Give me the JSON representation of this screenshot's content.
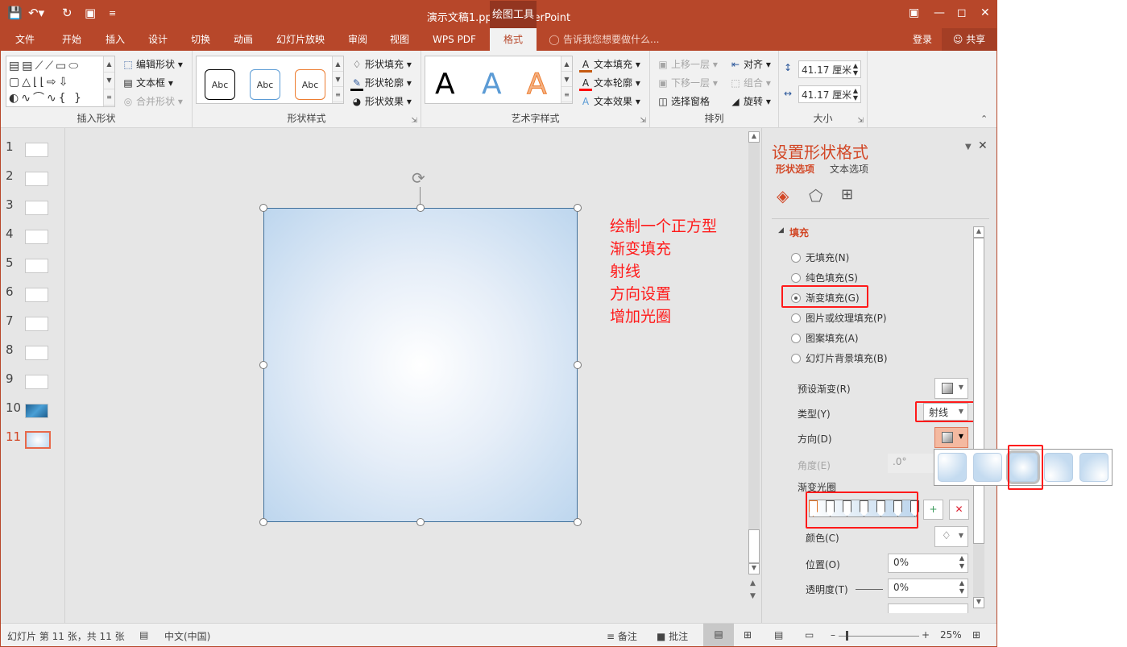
{
  "titlebar": {
    "title": "演示文稿1.pptx - PowerPoint",
    "context_tool": "绘图工具",
    "quick_access": [
      "save-icon",
      "undo-icon",
      "redo-icon",
      "present-icon",
      "customize-icon"
    ],
    "window_controls": [
      "ribbon-display-icon",
      "minimize-icon",
      "maximize-icon",
      "close-icon"
    ]
  },
  "tabs": [
    {
      "label": "文件"
    },
    {
      "label": "开始"
    },
    {
      "label": "插入"
    },
    {
      "label": "设计"
    },
    {
      "label": "切换"
    },
    {
      "label": "动画"
    },
    {
      "label": "幻灯片放映"
    },
    {
      "label": "审阅"
    },
    {
      "label": "视图"
    },
    {
      "label": "WPS PDF"
    },
    {
      "label": "格式",
      "active": true
    }
  ],
  "tell_me": "告诉我您想要做什么...",
  "login": "登录",
  "share": "共享",
  "ribbon": {
    "insert_shapes": {
      "label": "插入形状",
      "edit_shape": "编辑形状",
      "textbox": "文本框",
      "merge_shapes": "合并形状"
    },
    "shape_styles": {
      "label": "形状样式",
      "samples": [
        "Abc",
        "Abc",
        "Abc"
      ],
      "fill": "形状填充",
      "outline": "形状轮廓",
      "effects": "形状效果"
    },
    "wordart_styles": {
      "label": "艺术字样式",
      "samples": [
        "A",
        "A",
        "A"
      ],
      "text_fill": "文本填充",
      "text_outline": "文本轮廓",
      "text_effects": "文本效果"
    },
    "arrange": {
      "label": "排列",
      "bring_forward": "上移一层",
      "send_backward": "下移一层",
      "selection_pane": "选择窗格",
      "align": "对齐",
      "group": "组合",
      "rotate": "旋转"
    },
    "size": {
      "label": "大小",
      "height": "41.17 厘米",
      "width": "41.17 厘米"
    }
  },
  "thumbnails": [
    {
      "n": "1"
    },
    {
      "n": "2"
    },
    {
      "n": "3"
    },
    {
      "n": "4"
    },
    {
      "n": "5"
    },
    {
      "n": "6"
    },
    {
      "n": "7"
    },
    {
      "n": "8"
    },
    {
      "n": "9"
    },
    {
      "n": "10"
    },
    {
      "n": "11",
      "selected": true
    }
  ],
  "annotation": [
    "绘制一个正方型",
    "渐变填充",
    "射线",
    "方向设置",
    "增加光圈"
  ],
  "pane": {
    "title": "设置形状格式",
    "tab_shape": "形状选项",
    "tab_text": "文本选项",
    "section": "填充",
    "fill_options": [
      {
        "label": "无填充(N)",
        "checked": false
      },
      {
        "label": "纯色填充(S)",
        "checked": false
      },
      {
        "label": "渐变填充(G)",
        "checked": true
      },
      {
        "label": "图片或纹理填充(P)",
        "checked": false
      },
      {
        "label": "图案填充(A)",
        "checked": false
      },
      {
        "label": "幻灯片背景填充(B)",
        "checked": false
      }
    ],
    "preset_gradient": "预设渐变(R)",
    "type_label": "类型(Y)",
    "type_value": "射线",
    "direction_label": "方向(D)",
    "angle_label": "角度(E)",
    "angle_value": ".0°",
    "stops_label": "渐变光圈",
    "stop_count": 7,
    "color_label": "颜色(C)",
    "position_label": "位置(O)",
    "position_value": "0%",
    "transparency_label": "透明度(T)",
    "transparency_value": "0%"
  },
  "direction_options": 5,
  "direction_selected": 3,
  "status": {
    "slide_info": "幻灯片 第 11 张，共 11 张",
    "language": "中文(中国)",
    "notes": "备注",
    "comments": "批注",
    "zoom": "25%"
  }
}
